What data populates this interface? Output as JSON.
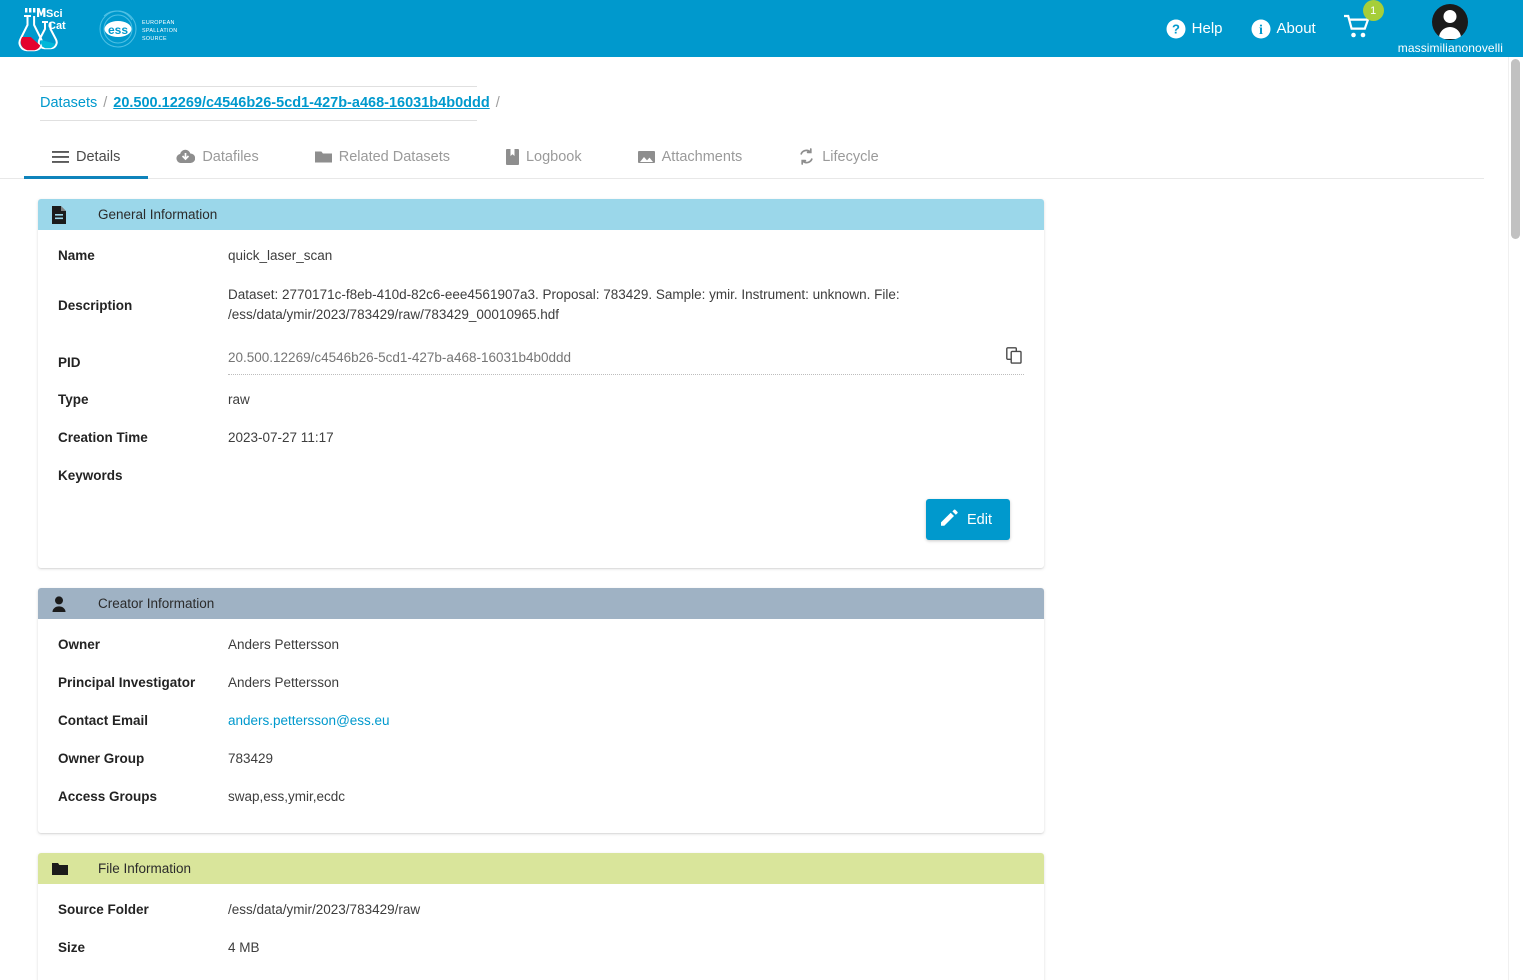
{
  "header": {
    "brand_primary": "SciCat",
    "brand_secondary": "EUROPEAN SPALLATION SOURCE",
    "help_label": "Help",
    "about_label": "About",
    "cart_count": "1",
    "username": "massimilianonovelli",
    "background_color": "#0099cd"
  },
  "breadcrumb": {
    "root_label": "Datasets",
    "separator": "/",
    "current_label": "20.500.12269/c4546b26-5cd1-427b-a468-16031b4b0ddd",
    "trailing_separator": "/"
  },
  "tabs": [
    {
      "label": "Details",
      "icon": "menu-icon",
      "active": true
    },
    {
      "label": "Datafiles",
      "icon": "cloud-download-icon",
      "active": false
    },
    {
      "label": "Related Datasets",
      "icon": "folder-icon",
      "active": false
    },
    {
      "label": "Logbook",
      "icon": "book-icon",
      "active": false
    },
    {
      "label": "Attachments",
      "icon": "image-icon",
      "active": false
    },
    {
      "label": "Lifecycle",
      "icon": "sync-icon",
      "active": false
    }
  ],
  "general_information": {
    "title": "General Information",
    "icon": "document-icon",
    "header_color": "#9bd7ea",
    "name_label": "Name",
    "name_value": "quick_laser_scan",
    "description_label": "Description",
    "description_value": "Dataset: 2770171c-f8eb-410d-82c6-eee4561907a3. Proposal: 783429. Sample: ymir. Instrument: unknown. File: /ess/data/ymir/2023/783429/raw/783429_00010965.hdf",
    "pid_label": "PID",
    "pid_value": "20.500.12269/c4546b26-5cd1-427b-a468-16031b4b0ddd",
    "pid_placeholder": "20.500.12269/c4546b26-5cd1-427b-a468-16031b4b0ddd",
    "copy_icon": "copy-icon",
    "type_label": "Type",
    "type_value": "raw",
    "creation_time_label": "Creation Time",
    "creation_time_value": "2023-07-27 11:17",
    "keywords_label": "Keywords",
    "keywords_value": "",
    "edit_label": "Edit"
  },
  "creator_information": {
    "title": "Creator Information",
    "icon": "person-icon",
    "header_color": "#9fb2c4",
    "rows": [
      {
        "label": "Owner",
        "value": "Anders Pettersson",
        "link": false
      },
      {
        "label": "Principal Investigator",
        "value": "Anders Pettersson",
        "link": false
      },
      {
        "label": "Contact Email",
        "value": "anders.pettersson@ess.eu",
        "link": true
      },
      {
        "label": "Owner Group",
        "value": "783429",
        "link": false
      },
      {
        "label": "Access Groups",
        "value": "swap,ess,ymir,ecdc",
        "link": false
      }
    ]
  },
  "file_information": {
    "title": "File Information",
    "icon": "folder-icon",
    "header_color": "#d9e59b",
    "rows": [
      {
        "label": "Source Folder",
        "value": "/ess/data/ymir/2023/783429/raw"
      },
      {
        "label": "Size",
        "value": "4 MB"
      }
    ]
  }
}
